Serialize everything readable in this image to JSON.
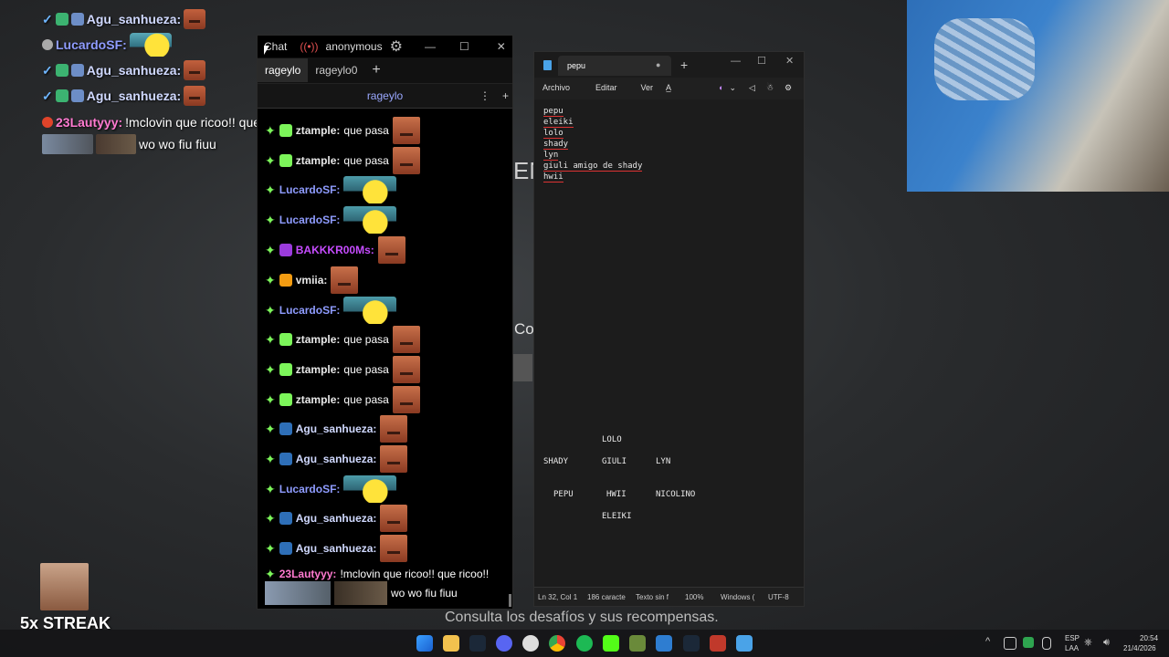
{
  "overlay": {
    "rows": [
      {
        "user": "Agu_sanhueza:",
        "color": "#d0d9ff"
      },
      {
        "user": "LucardoSF:",
        "color": "#8f9cff"
      },
      {
        "user": "Agu_sanhueza:",
        "color": "#d0d9ff"
      },
      {
        "user": "Agu_sanhueza:",
        "color": "#d0d9ff"
      }
    ],
    "lautyyy": {
      "user": "23Lautyyy:",
      "text": "!mclovin que ricoo!! que ricoo!!"
    },
    "wo": "wo wo fiu fiuu",
    "streak": "5x STREAK",
    "bg_fragment_1": "EN",
    "bg_fragment_2": "Co",
    "caption": "Consulta los desafíos y sus recompensas."
  },
  "chat": {
    "title_tab": "Chat",
    "user": "anonymous",
    "tabs": [
      "rageylo",
      "rageylo0"
    ],
    "channel": "rageylo",
    "messages": [
      {
        "user": "ztample:",
        "text": "que pasa",
        "color": "#e8e8e8"
      },
      {
        "user": "ztample:",
        "text": "que pasa",
        "color": "#e8e8e8"
      },
      {
        "user": "LucardoSF:",
        "text": "",
        "color": "#8f9cff"
      },
      {
        "user": "LucardoSF:",
        "text": "",
        "color": "#8f9cff"
      },
      {
        "user": "BAKKKR00Ms:",
        "text": "",
        "color": "#c64cff"
      },
      {
        "user": "vmiia:",
        "text": "",
        "color": "#e8e8e8"
      },
      {
        "user": "LucardoSF:",
        "text": "",
        "color": "#8f9cff"
      },
      {
        "user": "ztample:",
        "text": "que pasa",
        "color": "#e8e8e8"
      },
      {
        "user": "ztample:",
        "text": "que pasa",
        "color": "#e8e8e8"
      },
      {
        "user": "ztample:",
        "text": "que pasa",
        "color": "#e8e8e8"
      },
      {
        "user": "Agu_sanhueza:",
        "text": "",
        "color": "#d0d9ff"
      },
      {
        "user": "Agu_sanhueza:",
        "text": "",
        "color": "#d0d9ff"
      },
      {
        "user": "LucardoSF:",
        "text": "",
        "color": "#8f9cff"
      },
      {
        "user": "Agu_sanhueza:",
        "text": "",
        "color": "#d0d9ff"
      },
      {
        "user": "Agu_sanhueza:",
        "text": "",
        "color": "#d0d9ff"
      }
    ],
    "last_user": "23Lautyyy:",
    "last_text": "!mclovin que ricoo!! que ricoo!!",
    "wo": "wo wo fiu fiuu"
  },
  "notepad": {
    "tab": "pepu",
    "menu": [
      "Archivo",
      "Editar",
      "Ver"
    ],
    "lines": [
      "pepu",
      "eleiki",
      "lolo",
      "shady",
      "lyn",
      "giuli amigo de shady",
      "hwii"
    ],
    "grid": [
      "LOLO",
      "SHADY",
      "GIULI",
      "LYN",
      "PEPU",
      "HWII",
      "NICOLINO",
      "ELEIKI"
    ],
    "status": {
      "pos": "Ln 32, Col 1",
      "chars": "186 caracte",
      "format": "Texto sin f",
      "zoom": "100%",
      "eol": "Windows (",
      "enc": "UTF-8"
    }
  },
  "taskbar": {
    "lang1": "ESP",
    "lang2": "LAA",
    "time": "20:54",
    "date": "21/4/2026"
  }
}
